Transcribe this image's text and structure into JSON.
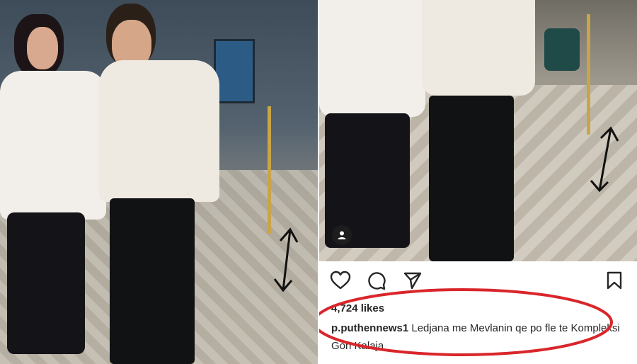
{
  "post": {
    "likes": "4,724 likes",
    "username": "p.puthennews1",
    "caption": "Ledjana me Mevlanin qe po fle te Kompleksi Gon Kalaja"
  },
  "icons": {
    "like": "heart-icon",
    "comment": "comment-icon",
    "share": "share-icon",
    "save": "bookmark-icon",
    "tagged_user": "user-tag-icon",
    "annotation": "double-arrow-icon"
  },
  "colors": {
    "annotation_red": "#d9262b",
    "text": "#262626",
    "pole_gold": "#c9a548"
  }
}
